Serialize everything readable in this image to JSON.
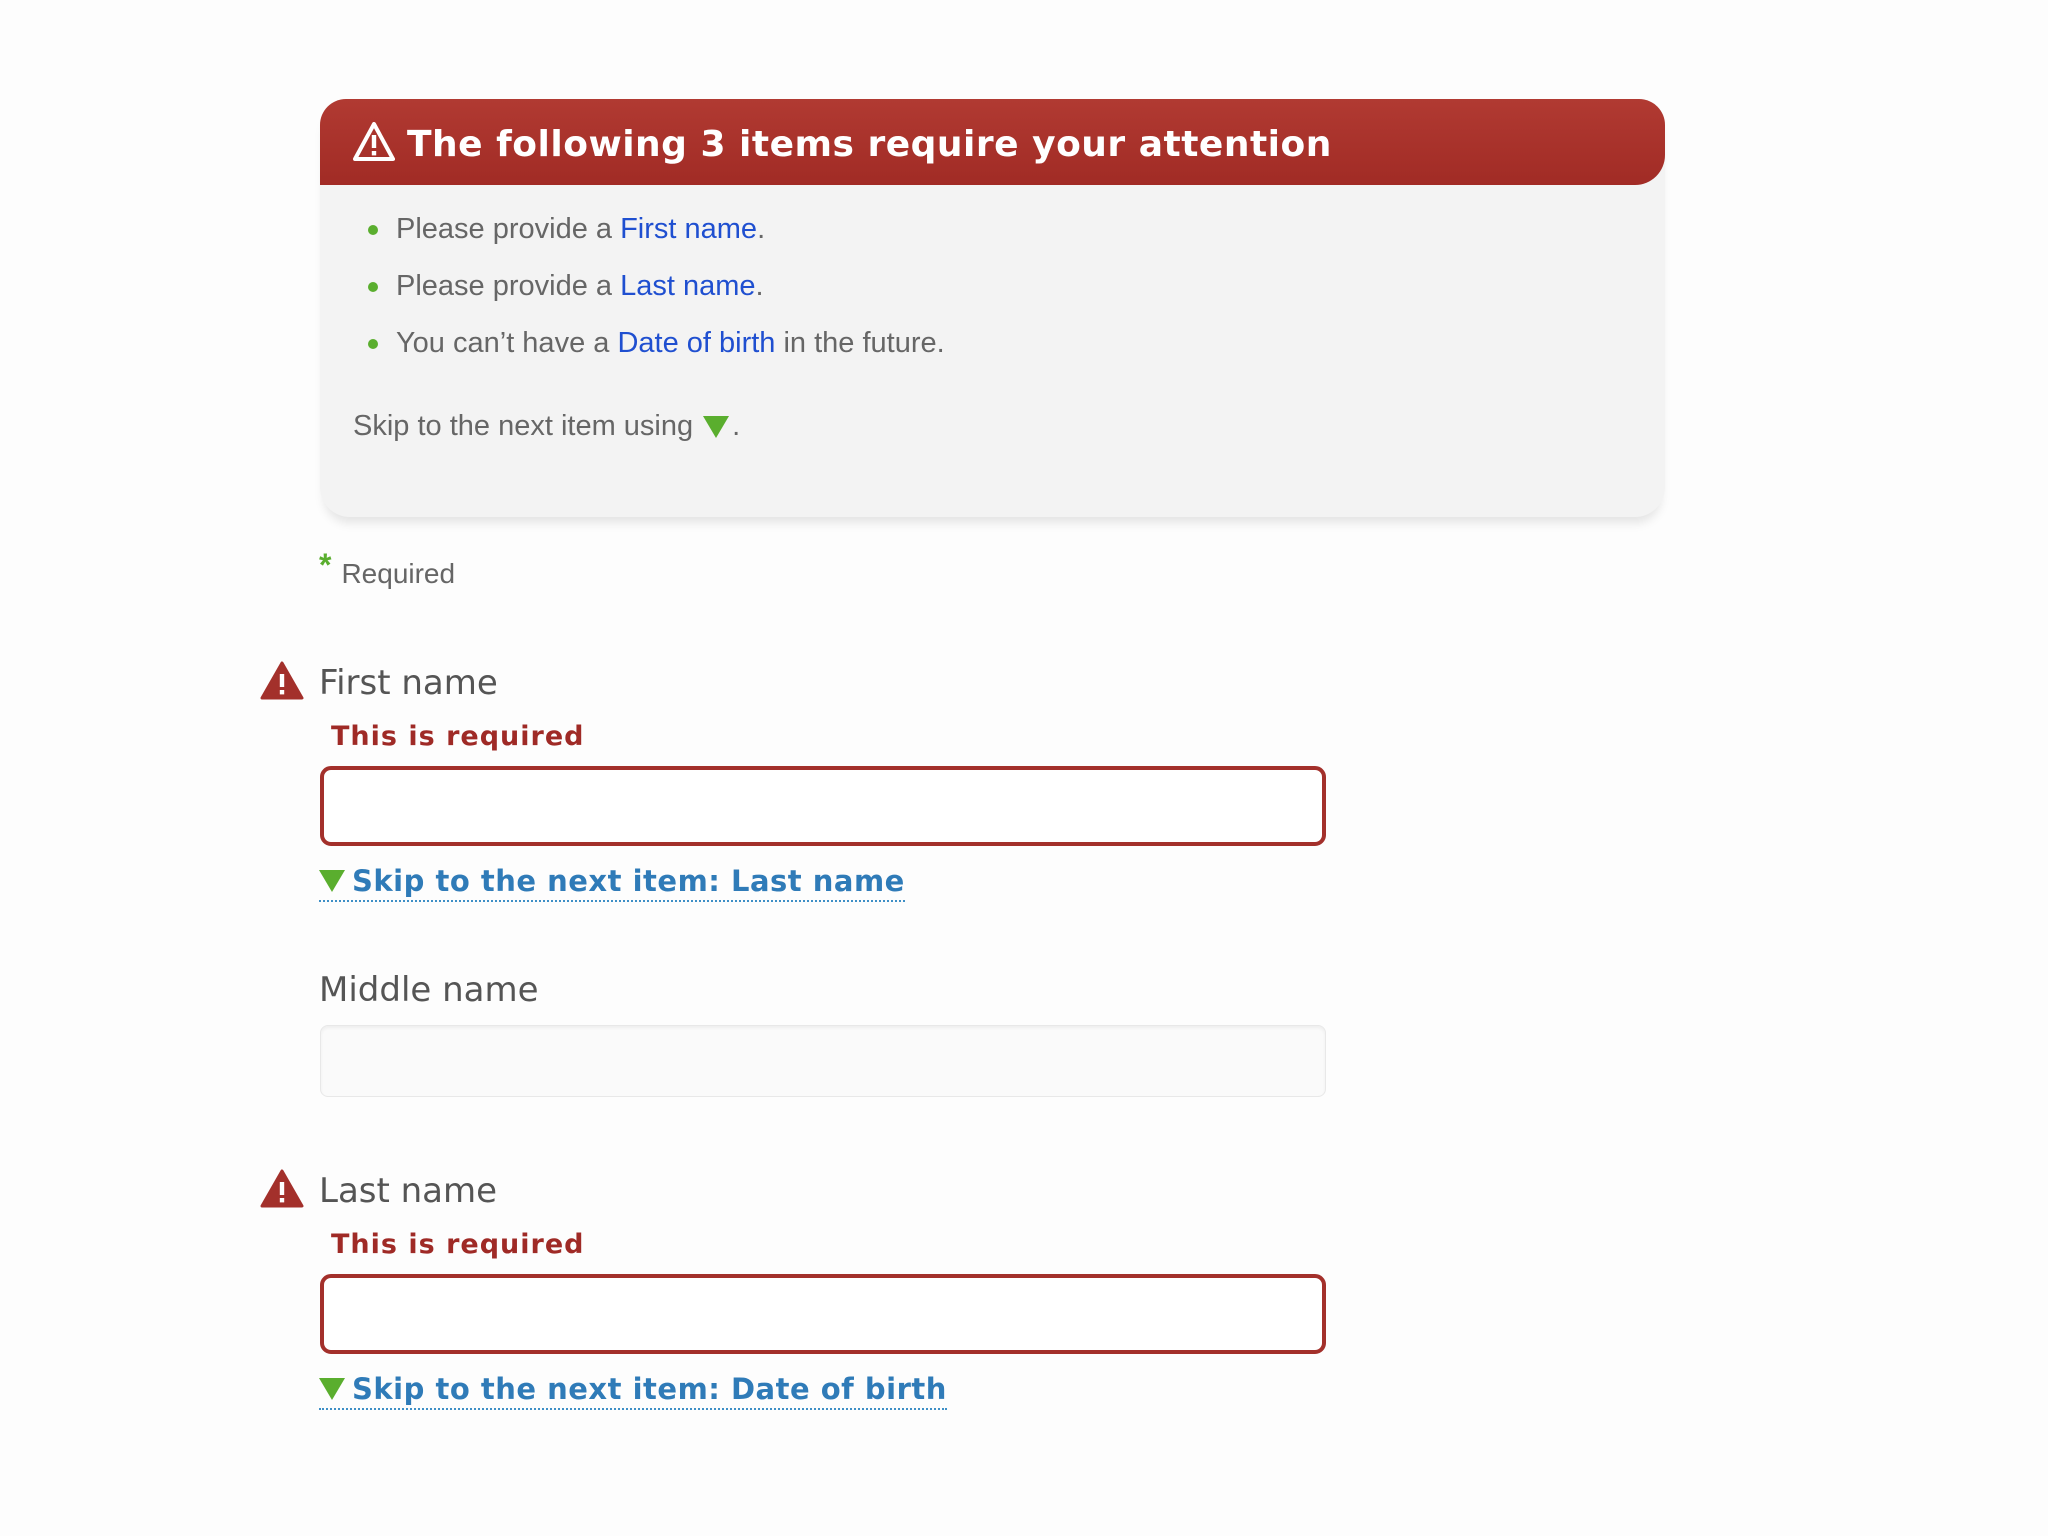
{
  "summary": {
    "title": "The following 3 items require your attention",
    "items": [
      {
        "prefix": "Please provide a ",
        "link": "First name",
        "suffix": "."
      },
      {
        "prefix": "Please provide a ",
        "link": "Last name",
        "suffix": "."
      },
      {
        "prefix": "You can’t have a ",
        "link": "Date of birth",
        "suffix": " in the future."
      }
    ],
    "skip_text": "Skip to the next item using",
    "skip_suffix": "."
  },
  "required_legend": {
    "star": "*",
    "label": "Required"
  },
  "fields": {
    "first_name": {
      "label": "First name",
      "error": "This is required",
      "value": "",
      "skip_link": "Skip to the next item: Last name"
    },
    "middle_name": {
      "label": "Middle name",
      "value": ""
    },
    "last_name": {
      "label": "Last name",
      "error": "This is required",
      "value": "",
      "skip_link": "Skip to the next item: Date of birth"
    }
  },
  "colors": {
    "error_red": "#a3302b",
    "accent_green": "#5aae2e",
    "link_blue": "#1f4fd0",
    "skip_link_blue": "#2f7bb8"
  },
  "icons": {
    "summary_warning": "warning-icon",
    "field_warning": "warning-icon",
    "skip_arrow": "triangle-down-icon",
    "bullet": "bullet-icon"
  }
}
